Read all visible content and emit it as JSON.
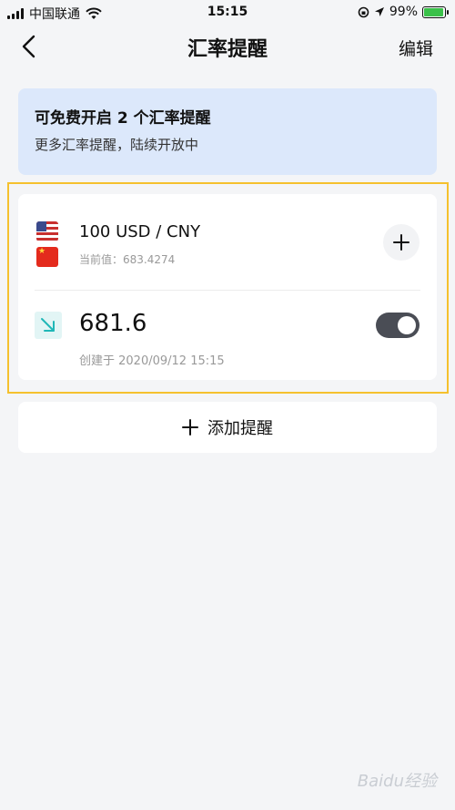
{
  "status_bar": {
    "carrier": "中国联通",
    "time": "15:15",
    "battery": "99%",
    "battery_level": 0.99
  },
  "nav": {
    "title": "汇率提醒",
    "edit_label": "编辑"
  },
  "banner": {
    "title": "可免费开启 2 个汇率提醒",
    "subtitle": "更多汇率提醒，陆续开放中"
  },
  "alert_card": {
    "pair": "100 USD / CNY",
    "current_value": "当前值：683.4274",
    "target": "681.6",
    "created": "创建于 2020/09/12 15:15",
    "toggle_on": true
  },
  "add_button": {
    "label": "添加提醒"
  },
  "watermark": "Baidu经验",
  "colors": {
    "banner_bg": "#dce8fb",
    "highlight_border": "#f5c12e",
    "toggle_on": "#4a4d55",
    "trend_icon": "#1fb7b7"
  }
}
